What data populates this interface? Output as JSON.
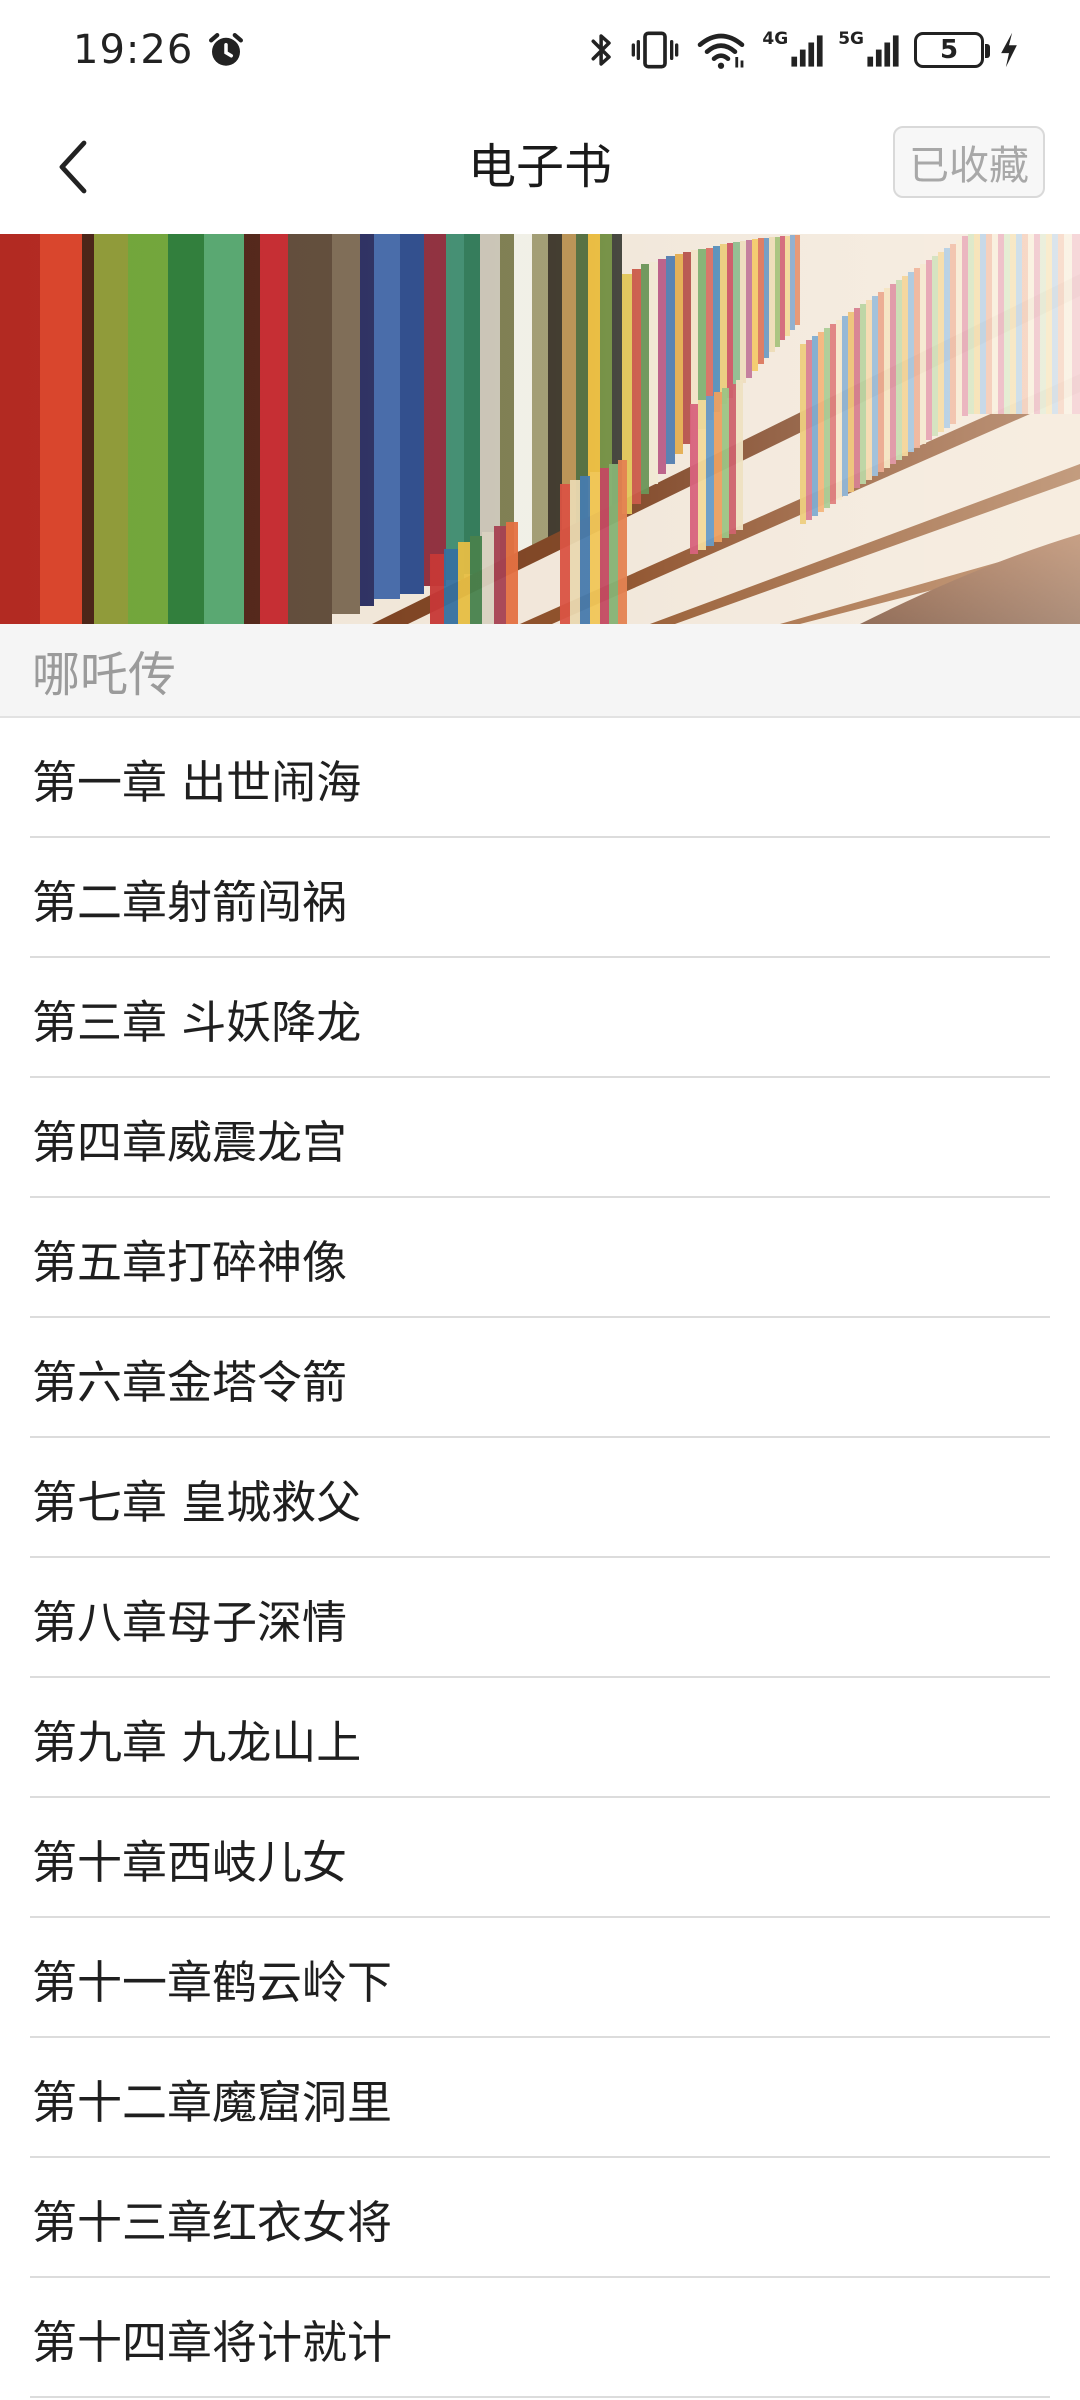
{
  "status_bar": {
    "time": "19:26",
    "alarm_icon": "alarm-clock-icon",
    "icons": [
      "bluetooth-icon",
      "vibrate-icon",
      "wifi-icon",
      "signal-4g-icon",
      "signal-5g-icon",
      "charging-icon"
    ],
    "network_4g": "4G",
    "network_5g": "5G",
    "battery_level": "5"
  },
  "header": {
    "back_icon": "chevron-left-icon",
    "title": "电子书",
    "collected_label": "已收藏"
  },
  "banner": {
    "image": "library-bookshelf-image"
  },
  "book": {
    "title": "哪吒传"
  },
  "chapters": [
    {
      "label": "第一章 出世闹海"
    },
    {
      "label": "第二章射箭闯祸"
    },
    {
      "label": "第三章 斗妖降龙"
    },
    {
      "label": "第四章威震龙宫"
    },
    {
      "label": "第五章打碎神像"
    },
    {
      "label": "第六章金塔令箭"
    },
    {
      "label": "第七章 皇城救父"
    },
    {
      "label": "第八章母子深情"
    },
    {
      "label": "第九章 九龙山上"
    },
    {
      "label": "第十章西岐儿女"
    },
    {
      "label": "第十一章鹤云岭下"
    },
    {
      "label": "第十二章魔窟洞里"
    },
    {
      "label": "第十三章红衣女将"
    },
    {
      "label": "第十四章将计就计"
    }
  ]
}
